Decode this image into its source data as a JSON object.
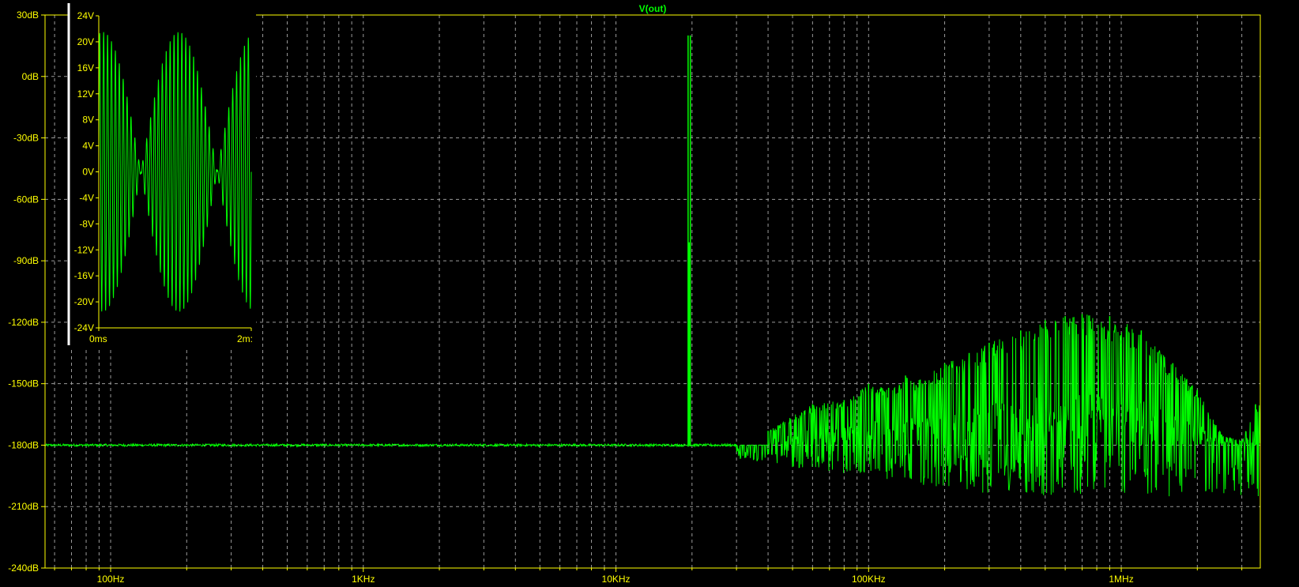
{
  "colors": {
    "background": "#000000",
    "axis": "#ffff00",
    "grid": "#9a9a9a",
    "trace": "#00ff00",
    "inset_border": "#ffffff"
  },
  "chart_data": [
    {
      "type": "line",
      "title": "V(out)",
      "x_scale": "log",
      "xlim": [
        55,
        3550000
      ],
      "ylim": [
        -240,
        30
      ],
      "xlabel": "",
      "ylabel": "",
      "grid": true,
      "x_ticks": [
        {
          "value": 100,
          "label": "100Hz"
        },
        {
          "value": 1000,
          "label": "1KHz"
        },
        {
          "value": 10000,
          "label": "10KHz"
        },
        {
          "value": 100000,
          "label": "100KHz"
        },
        {
          "value": 1000000,
          "label": "1MHz"
        }
      ],
      "y_ticks": [
        {
          "value": 30,
          "label": "30dB"
        },
        {
          "value": 0,
          "label": "0dB"
        },
        {
          "value": -30,
          "label": "-30dB"
        },
        {
          "value": -60,
          "label": "-60dB"
        },
        {
          "value": -90,
          "label": "-90dB"
        },
        {
          "value": -120,
          "label": "-120dB"
        },
        {
          "value": -150,
          "label": "-150dB"
        },
        {
          "value": -180,
          "label": "-180dB"
        },
        {
          "value": -210,
          "label": "-210dB"
        },
        {
          "value": -240,
          "label": "-240dB"
        }
      ],
      "noise_floor_db": -180,
      "series": [
        {
          "name": "V(out)",
          "peaks": [
            {
              "x": 19300,
              "y": 20
            },
            {
              "x": 19500,
              "y": -81
            },
            {
              "x": 19700,
              "y": 20
            },
            {
              "x": 40000,
              "y": -173
            },
            {
              "x": 60000,
              "y": -160
            },
            {
              "x": 80000,
              "y": -158
            },
            {
              "x": 100000,
              "y": -150
            },
            {
              "x": 120000,
              "y": -152
            },
            {
              "x": 140000,
              "y": -146
            },
            {
              "x": 160000,
              "y": -148
            },
            {
              "x": 200000,
              "y": -140
            },
            {
              "x": 250000,
              "y": -135
            },
            {
              "x": 300000,
              "y": -130
            },
            {
              "x": 400000,
              "y": -124
            },
            {
              "x": 500000,
              "y": -119
            },
            {
              "x": 600000,
              "y": -117
            },
            {
              "x": 700000,
              "y": -116
            },
            {
              "x": 900000,
              "y": -117
            },
            {
              "x": 1200000,
              "y": -124
            },
            {
              "x": 1600000,
              "y": -140
            },
            {
              "x": 2000000,
              "y": -153
            },
            {
              "x": 2500000,
              "y": -175
            },
            {
              "x": 3000000,
              "y": -178
            },
            {
              "x": 3400000,
              "y": -160
            }
          ]
        }
      ]
    },
    {
      "type": "line",
      "title": "",
      "xlim": [
        0,
        2
      ],
      "ylim": [
        -24,
        24
      ],
      "xlabel": "",
      "ylabel": "",
      "grid": false,
      "x_ticks": [
        {
          "value": 0,
          "label": "0ms"
        },
        {
          "value": 2,
          "label": "2m:"
        }
      ],
      "y_ticks": [
        {
          "value": 24,
          "label": "24V"
        },
        {
          "value": 20,
          "label": "20V"
        },
        {
          "value": 16,
          "label": "16V"
        },
        {
          "value": 12,
          "label": "12V"
        },
        {
          "value": 8,
          "label": "8V"
        },
        {
          "value": 4,
          "label": "4V"
        },
        {
          "value": 0,
          "label": "0V"
        },
        {
          "value": -4,
          "label": "-4V"
        },
        {
          "value": -8,
          "label": "-8V"
        },
        {
          "value": -12,
          "label": "-12V"
        },
        {
          "value": -16,
          "label": "-16V"
        },
        {
          "value": -20,
          "label": "-20V"
        },
        {
          "value": -24,
          "label": "-24V"
        }
      ],
      "series": [
        {
          "name": "V(out)",
          "amplitude_v": 21.5,
          "carrier_khz": 19.5,
          "envelope_period_ms": 1.0
        }
      ]
    }
  ]
}
